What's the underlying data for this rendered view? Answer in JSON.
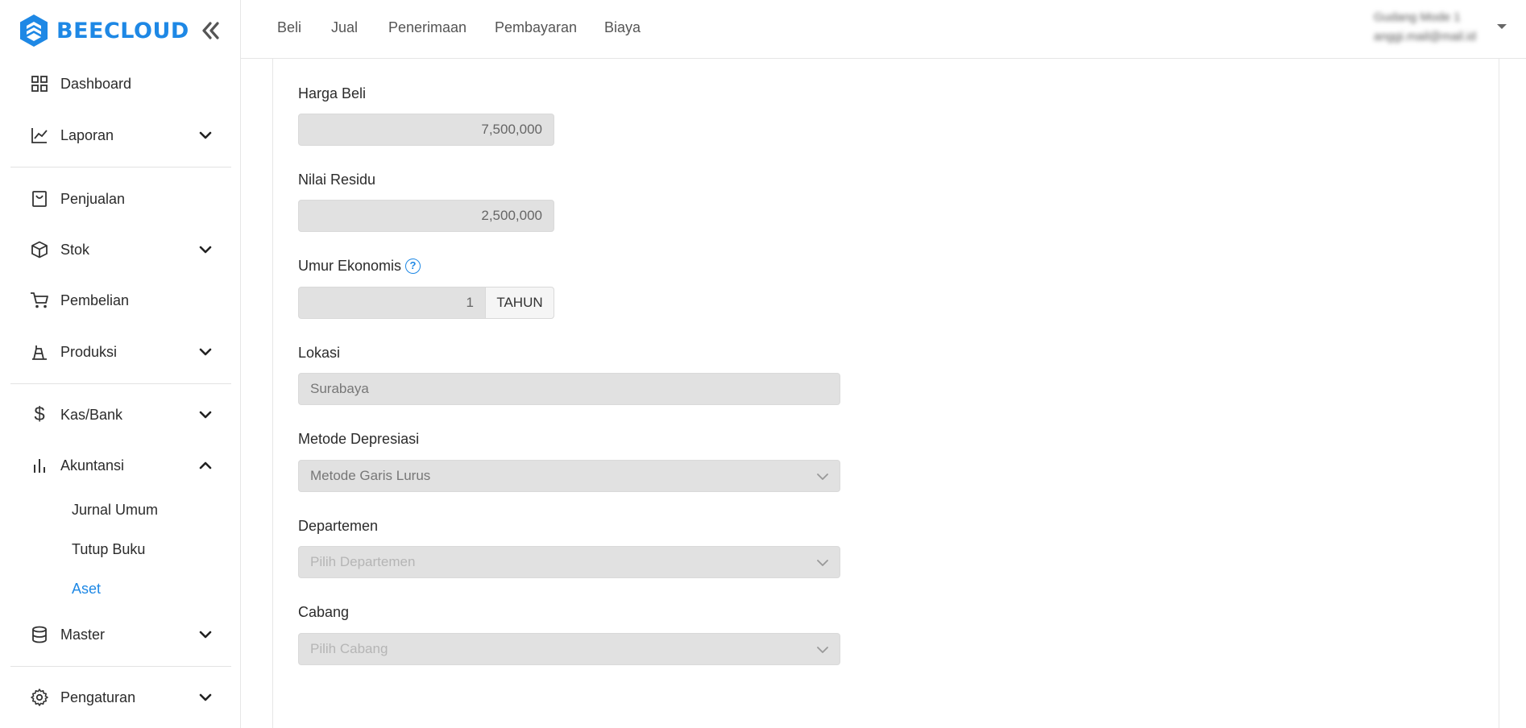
{
  "brand": {
    "name": "BEECLOUD",
    "color": "#1e88e5"
  },
  "sidebar": {
    "items": [
      {
        "label": "Dashboard",
        "icon": "grid-icon",
        "chevron": "none"
      },
      {
        "label": "Laporan",
        "icon": "line-chart-icon",
        "chevron": "down"
      },
      {
        "label": "Penjualan",
        "icon": "shopping-bag-icon",
        "chevron": "none"
      },
      {
        "label": "Stok",
        "icon": "box-icon",
        "chevron": "down"
      },
      {
        "label": "Pembelian",
        "icon": "cart-icon",
        "chevron": "none"
      },
      {
        "label": "Produksi",
        "icon": "factory-icon",
        "chevron": "down"
      },
      {
        "label": "Kas/Bank",
        "icon": "dollar-icon",
        "chevron": "down"
      },
      {
        "label": "Akuntansi",
        "icon": "bar-chart-icon",
        "chevron": "up"
      },
      {
        "label": "Master",
        "icon": "database-icon",
        "chevron": "down"
      },
      {
        "label": "Pengaturan",
        "icon": "gear-icon",
        "chevron": "down"
      }
    ],
    "sub_items": [
      {
        "label": "Jurnal Umum",
        "active": false
      },
      {
        "label": "Tutup Buku",
        "active": false
      },
      {
        "label": "Aset",
        "active": true
      }
    ]
  },
  "topbar": {
    "menu": [
      "Beli",
      "Jual",
      "Penerimaan",
      "Pembayaran",
      "Biaya"
    ],
    "user": {
      "line1": "Gudang Mode 1",
      "line2": "anggi.mail@mail.id"
    }
  },
  "form": {
    "harga_beli": {
      "label": "Harga Beli",
      "value": "7,500,000"
    },
    "nilai_residu": {
      "label": "Nilai Residu",
      "value": "2,500,000"
    },
    "umur_ekonomis": {
      "label": "Umur Ekonomis",
      "value": "1",
      "unit": "TAHUN",
      "help_icon": "question-circle-icon"
    },
    "lokasi": {
      "label": "Lokasi",
      "value": "Surabaya"
    },
    "metode_depresiasi": {
      "label": "Metode Depresiasi",
      "value": "Metode Garis Lurus"
    },
    "departemen": {
      "label": "Departemen",
      "placeholder": "Pilih Departemen"
    },
    "cabang": {
      "label": "Cabang",
      "placeholder": "Pilih Cabang"
    }
  }
}
